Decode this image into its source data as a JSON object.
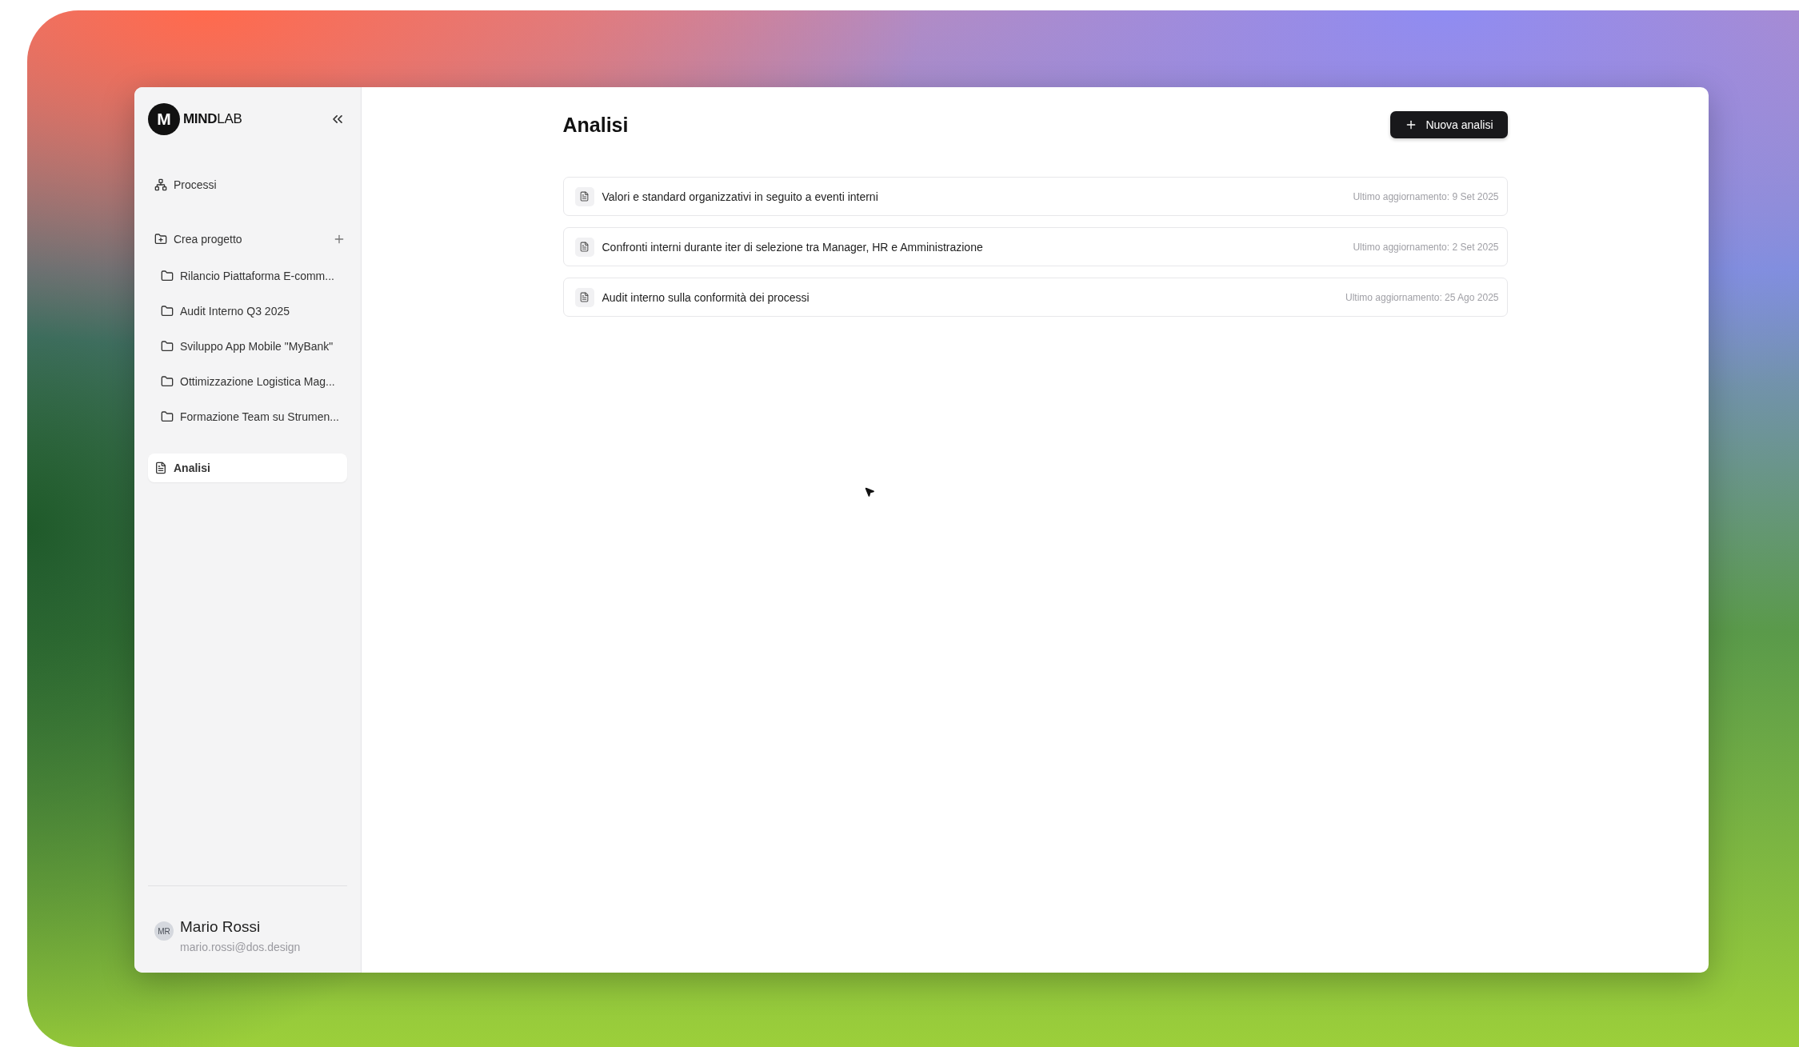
{
  "brand": {
    "mark": "M",
    "name": "**MIND**LAB"
  },
  "sidebar": {
    "nav": [
      {
        "kind": "link",
        "label": "Processi",
        "selected": false
      },
      {
        "kind": "group",
        "label": "Crea progetto",
        "children": [
          {
            "label": "Rilancio Piattaforma E-comm...",
            "selected": false
          },
          {
            "label": "Audit Interno Q3 2025",
            "selected": false
          },
          {
            "label": "Sviluppo App Mobile \"MyBank\"",
            "selected": false
          },
          {
            "label": "Ottimizzazione Logistica Mag...",
            "selected": false
          },
          {
            "label": "Formazione Team su Strumen...",
            "selected": false
          }
        ]
      },
      {
        "kind": "link",
        "label": "Analisi",
        "selected": true
      }
    ]
  },
  "user": {
    "initials": "MR",
    "name": "Mario Rossi",
    "email": "mario.rossi@dos.design"
  },
  "page": {
    "title": "Analisi",
    "new_button": "Nuova analisi"
  },
  "analyses": [
    {
      "title": "Valori e standard organizzativi in seguito a eventi interni",
      "updated": "Ultimo aggiornamento: 9 Set 2025"
    },
    {
      "title": "Confronti interni durante iter di selezione tra Manager, HR e Amministrazione",
      "updated": "Ultimo aggiornamento: 2 Set 2025"
    },
    {
      "title": "Audit interno sulla conformità dei processi",
      "updated": "Ultimo aggiornamento: 25 Ago 2025"
    }
  ]
}
